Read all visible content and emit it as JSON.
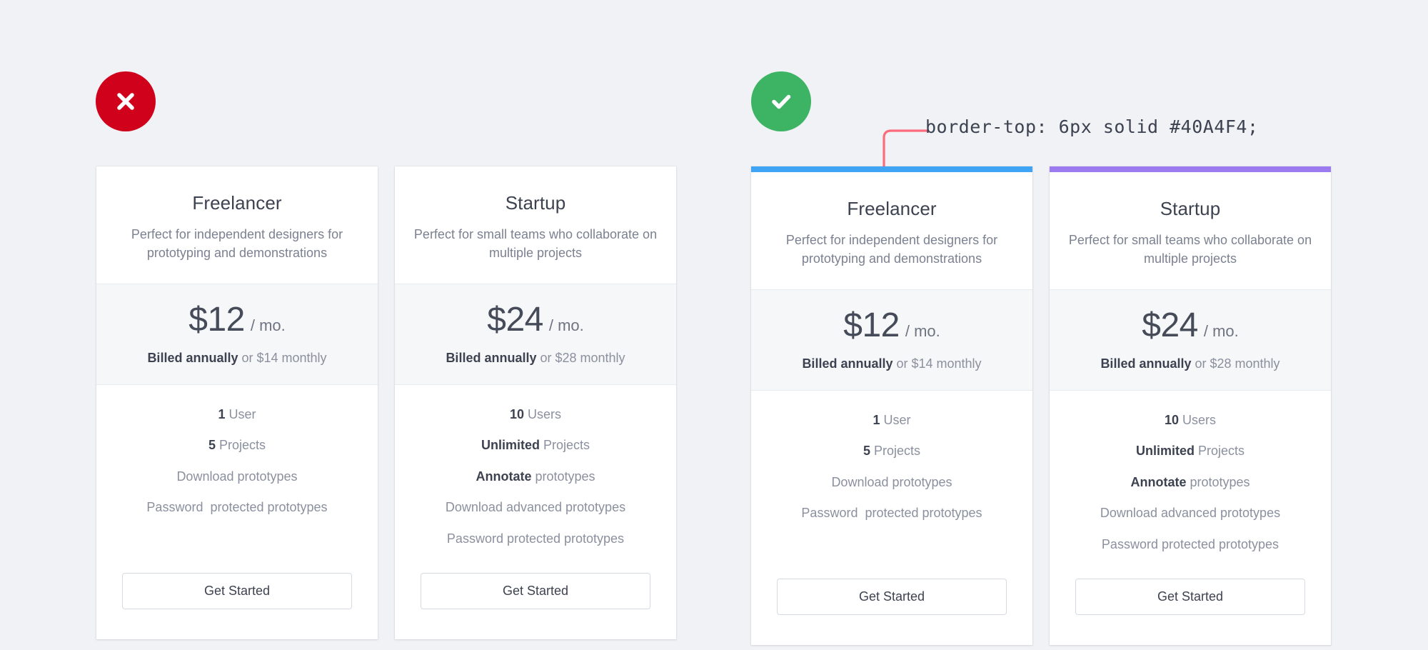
{
  "badges": {
    "bad": {
      "icon": "cross-circle-icon",
      "color": "#d0021b",
      "label": "incorrect-example"
    },
    "good": {
      "icon": "check-circle-icon",
      "color": "#3cb464",
      "label": "correct-example"
    }
  },
  "annotation": {
    "code": "border-top: 6px solid #40A4F4;",
    "connector_color": "#fb6b7b"
  },
  "colors": {
    "page_background": "#f0f2f5",
    "card_background": "#ffffff",
    "price_background": "#f6f7f9",
    "rule_blue": "#40A4F4",
    "rule_purple": "#9B7BEF",
    "text_dark": "#3c4250",
    "text_muted": "#8a909e"
  },
  "groups": [
    {
      "name": "without-top-border",
      "cards": [
        {
          "plan": "Freelancer",
          "tagline": "Perfect for independent designers for prototyping and demonstrations",
          "top_rule": null,
          "price_amount": "$12",
          "price_period": "/ mo.",
          "billing_strong": "Billed annually",
          "billing_rest": " or $14 monthly",
          "features": [
            {
              "strong": "1",
              "rest": " User"
            },
            {
              "strong": "5",
              "rest": " Projects"
            },
            {
              "strong": "",
              "rest": "Download prototypes"
            },
            {
              "strong": "",
              "rest": "Password  protected prototypes"
            }
          ],
          "cta": "Get Started"
        },
        {
          "plan": "Startup",
          "tagline": "Perfect for small teams who collaborate on multiple projects",
          "top_rule": null,
          "price_amount": "$24",
          "price_period": "/ mo.",
          "billing_strong": "Billed annually",
          "billing_rest": " or $28 monthly",
          "features": [
            {
              "strong": "10",
              "rest": " Users"
            },
            {
              "strong": "Unlimited",
              "rest": " Projects"
            },
            {
              "strong": "Annotate",
              "rest": " prototypes"
            },
            {
              "strong": "",
              "rest": "Download advanced prototypes"
            },
            {
              "strong": "",
              "rest": "Password protected prototypes"
            }
          ],
          "cta": "Get Started"
        }
      ]
    },
    {
      "name": "with-top-border",
      "cards": [
        {
          "plan": "Freelancer",
          "tagline": "Perfect for independent designers for prototyping and demonstrations",
          "top_rule": "#40A4F4",
          "price_amount": "$12",
          "price_period": "/ mo.",
          "billing_strong": "Billed annually",
          "billing_rest": " or $14 monthly",
          "features": [
            {
              "strong": "1",
              "rest": " User"
            },
            {
              "strong": "5",
              "rest": " Projects"
            },
            {
              "strong": "",
              "rest": "Download prototypes"
            },
            {
              "strong": "",
              "rest": "Password  protected prototypes"
            }
          ],
          "cta": "Get Started"
        },
        {
          "plan": "Startup",
          "tagline": "Perfect for small teams who collaborate on multiple projects",
          "top_rule": "#9B7BEF",
          "price_amount": "$24",
          "price_period": "/ mo.",
          "billing_strong": "Billed annually",
          "billing_rest": " or $28 monthly",
          "features": [
            {
              "strong": "10",
              "rest": " Users"
            },
            {
              "strong": "Unlimited",
              "rest": " Projects"
            },
            {
              "strong": "Annotate",
              "rest": " prototypes"
            },
            {
              "strong": "",
              "rest": "Download advanced prototypes"
            },
            {
              "strong": "",
              "rest": "Password protected prototypes"
            }
          ],
          "cta": "Get Started"
        }
      ]
    }
  ]
}
